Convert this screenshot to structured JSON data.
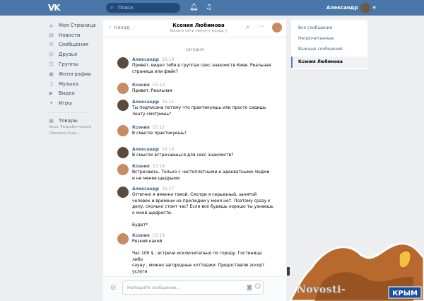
{
  "header": {
    "logo": "VK",
    "search_placeholder": "Поиск",
    "user_name": "Александр"
  },
  "menu": {
    "items": [
      {
        "icon": "home-icon",
        "glyph": "⌂",
        "label": "Моя Страница"
      },
      {
        "icon": "news-icon",
        "glyph": "▤",
        "label": "Новости"
      },
      {
        "icon": "messages-icon",
        "glyph": "✉",
        "label": "Сообщения"
      },
      {
        "icon": "friends-icon",
        "glyph": "☺",
        "label": "Друзья"
      },
      {
        "icon": "groups-icon",
        "glyph": "☷",
        "label": "Группы"
      },
      {
        "icon": "photos-icon",
        "glyph": "▣",
        "label": "Фотографии"
      },
      {
        "icon": "music-icon",
        "glyph": "♫",
        "label": "Музыка"
      },
      {
        "icon": "video-icon",
        "glyph": "▶",
        "label": "Видео"
      },
      {
        "icon": "games-icon",
        "glyph": "✦",
        "label": "Игры"
      },
      {
        "icon": "goods-icon",
        "glyph": "▦",
        "label": "Товары"
      }
    ],
    "footer_line1": "Блог  Разработчикам",
    "footer_line2": "Реклама  Ещё ⌄"
  },
  "chat": {
    "back_label": "Назад",
    "title": "Ксения Любимова",
    "subtitle": "была в сети минуту назад",
    "day_label": "сегодня",
    "messages": [
      {
        "sender": "Александр",
        "time": "15:10",
        "avatar": "m",
        "text": "Привет, видел тебя в группах секс знакомств Киев. Реальная\nстраница или фейк?"
      },
      {
        "sender": "Ксения",
        "time": "15:10",
        "avatar": "f",
        "text": "Привет. Реальная"
      },
      {
        "sender": "Александр",
        "time": "15:11",
        "avatar": "m",
        "text": "Ты подписана потому что практикуешь или просто сидишь\nленту смотришь?"
      },
      {
        "sender": "Ксения",
        "time": "15:12",
        "avatar": "f",
        "text": "В смысле практикуешь?"
      },
      {
        "sender": "Александр",
        "time": "15:13",
        "avatar": "m",
        "text": "В смысле встречаешься для секс знакомств?"
      },
      {
        "sender": "Ксения",
        "time": "15:14",
        "avatar": "f",
        "text": "Встречаюсь. Только с чистоплотными и адекватными людми\nи не менее щедрыми"
      },
      {
        "sender": "Александр",
        "time": "15:17",
        "avatar": "m",
        "text": "Отлично я именно такой. Смотри я серьезный, занятой\nчеловек и времени на прелюдии у меня нет. Поэтому сразу к\nделу, сколько стоит час? Если все будешь хорошо ты узнаешь\nо моей щедрости.\n\nБудет*"
      },
      {
        "sender": "Ксения",
        "time": "15:19",
        "avatar": "f",
        "text": "Резкий какой\n\nЧас 100 $ , встречи исключительно по городу. Гостиница либо\nсауну , можно загородные коттеджи. Предоставлю эскорт\nуслуги"
      }
    ],
    "composer_placeholder": "Напишите сообщение..."
  },
  "right_panel": {
    "all_messages": "Все сообщения",
    "unread": "Непрочитанные",
    "important": "Важные сообщения",
    "selected_dialog": "Ксения Любимова"
  },
  "watermark": {
    "text": "Novosti-",
    "badge": "КРЫМ"
  }
}
